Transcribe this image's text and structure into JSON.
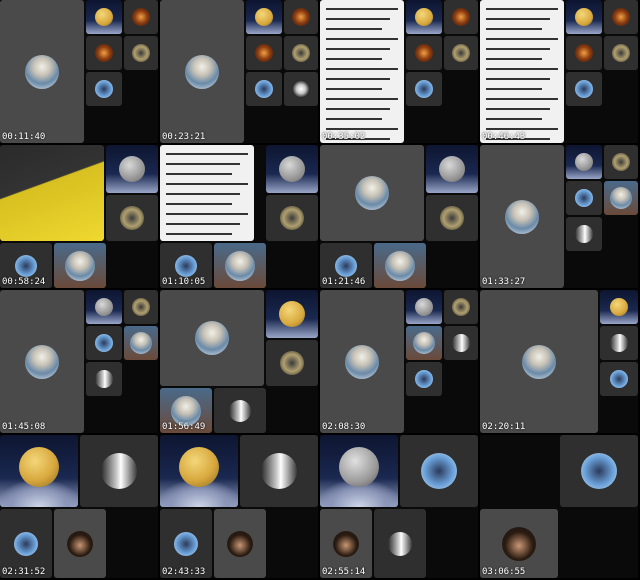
{
  "window": {
    "title": ""
  },
  "timestamps": [
    "00:11:40",
    "00:23:21",
    "00:35:02",
    "00:46:43",
    "00:58:24",
    "01:10:05",
    "01:21:46",
    "01:33:27",
    "01:45:08",
    "01:56:49",
    "02:08:30",
    "02:20:11",
    "02:31:52",
    "02:43:33",
    "02:55:14",
    "03:06:55"
  ],
  "tiles_accent": {
    "gray_tile": "#4a4a4a",
    "dark_tile": "#2f2f2f",
    "paper_tile": "#f1f1f1",
    "night_sky": "#1a2850"
  },
  "icons": {
    "speaker_avatar": "old-scholar-avatar",
    "moon_avatar": "moon-avatar",
    "moto_avatar": "motorcycle-avatar",
    "man_avatar": "bearded-man-avatar"
  }
}
